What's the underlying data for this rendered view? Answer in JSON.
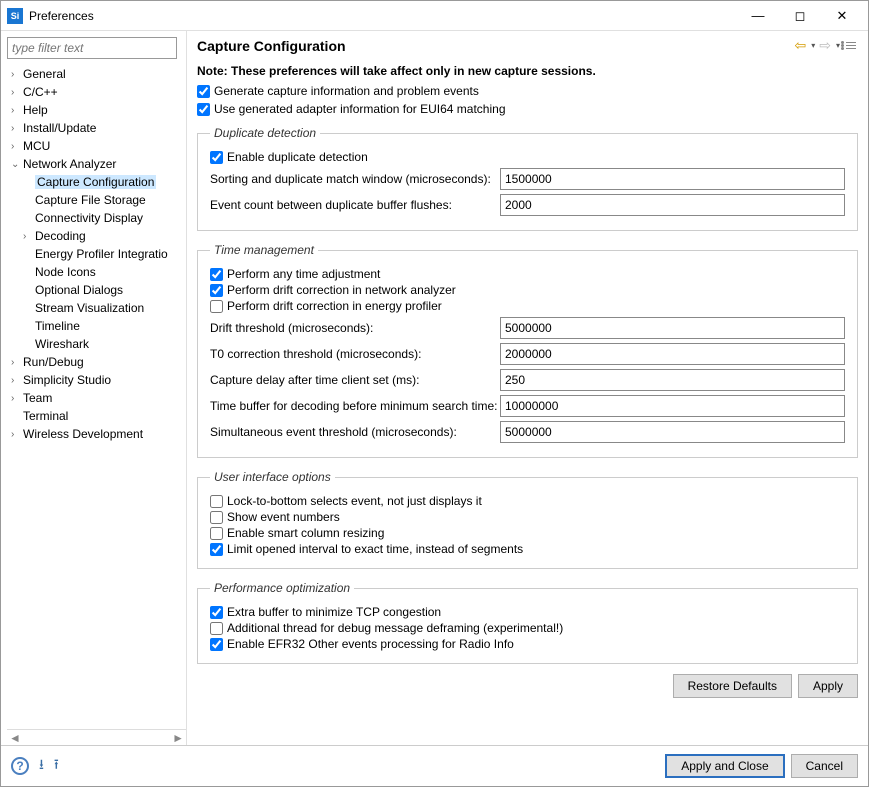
{
  "window": {
    "title": "Preferences"
  },
  "filter_placeholder": "type filter text",
  "tree": {
    "items": [
      {
        "label": "General",
        "expand": false,
        "level": 1,
        "hasChildren": true
      },
      {
        "label": "C/C++",
        "expand": false,
        "level": 1,
        "hasChildren": true
      },
      {
        "label": "Help",
        "expand": false,
        "level": 1,
        "hasChildren": true
      },
      {
        "label": "Install/Update",
        "expand": false,
        "level": 1,
        "hasChildren": true
      },
      {
        "label": "MCU",
        "expand": false,
        "level": 1,
        "hasChildren": true
      },
      {
        "label": "Network Analyzer",
        "expand": true,
        "level": 1,
        "hasChildren": true
      },
      {
        "label": "Capture Configuration",
        "level": 2,
        "selected": true
      },
      {
        "label": "Capture File Storage",
        "level": 2
      },
      {
        "label": "Connectivity Display",
        "level": 2
      },
      {
        "label": "Decoding",
        "level": 2,
        "hasChildren": true
      },
      {
        "label": "Energy Profiler Integratio",
        "level": 2
      },
      {
        "label": "Node Icons",
        "level": 2
      },
      {
        "label": "Optional Dialogs",
        "level": 2
      },
      {
        "label": "Stream Visualization",
        "level": 2
      },
      {
        "label": "Timeline",
        "level": 2
      },
      {
        "label": "Wireshark",
        "level": 2
      },
      {
        "label": "Run/Debug",
        "expand": false,
        "level": 1,
        "hasChildren": true
      },
      {
        "label": "Simplicity Studio",
        "expand": false,
        "level": 1,
        "hasChildren": true
      },
      {
        "label": "Team",
        "expand": false,
        "level": 1,
        "hasChildren": true
      },
      {
        "label": "Terminal",
        "level": 1
      },
      {
        "label": "Wireless Development",
        "expand": false,
        "level": 1,
        "hasChildren": true
      }
    ]
  },
  "page": {
    "title": "Capture Configuration",
    "note": "Note: These preferences will take affect only in new capture sessions.",
    "generate_info": "Generate capture information and problem events",
    "use_adapter": "Use generated adapter information for EUI64 matching",
    "dup": {
      "legend": "Duplicate detection",
      "enable": "Enable duplicate detection",
      "sort_label": "Sorting and duplicate match window (microseconds):",
      "sort_val": "1500000",
      "count_label": "Event count between duplicate buffer flushes:",
      "count_val": "2000"
    },
    "time": {
      "legend": "Time management",
      "any": "Perform any time adjustment",
      "drift_na": "Perform drift correction in network analyzer",
      "drift_ep": "Perform drift correction in energy profiler",
      "drift_thr_label": "Drift threshold (microseconds):",
      "drift_thr_val": "5000000",
      "t0_label": "T0 correction threshold (microseconds):",
      "t0_val": "2000000",
      "delay_label": "Capture delay after time client set (ms):",
      "delay_val": "250",
      "buffer_label": "Time buffer for decoding before minimum search time:",
      "buffer_val": "10000000",
      "sim_label": "Simultaneous event threshold (microseconds):",
      "sim_val": "5000000"
    },
    "ui": {
      "legend": "User interface options",
      "lock": "Lock-to-bottom selects event, not just displays it",
      "show_nums": "Show event numbers",
      "smart": "Enable smart column resizing",
      "limit": "Limit opened interval to exact time, instead of segments"
    },
    "perf": {
      "legend": "Performance optimization",
      "extra": "Extra buffer to minimize TCP congestion",
      "thread": "Additional thread for debug message deframing (experimental!)",
      "efr": "Enable EFR32 Other events processing for Radio Info"
    },
    "buttons": {
      "restore": "Restore Defaults",
      "apply": "Apply",
      "apply_close": "Apply and Close",
      "cancel": "Cancel"
    }
  }
}
